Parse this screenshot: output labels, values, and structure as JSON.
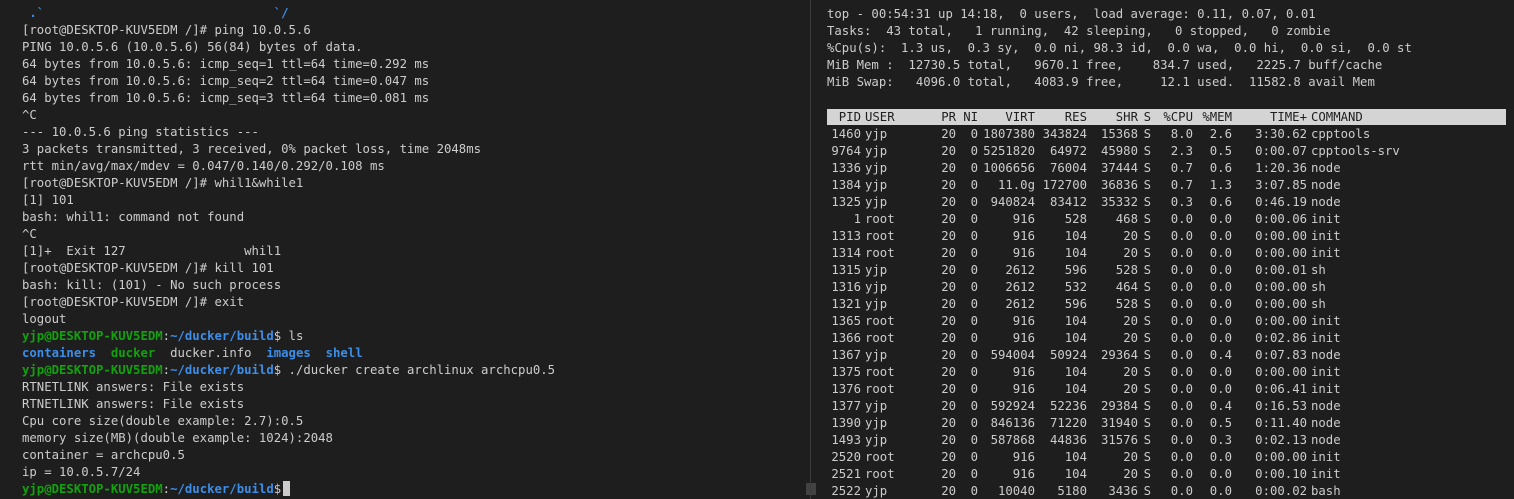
{
  "left_terminal": {
    "lines": [
      {
        "segments": [
          {
            "text": " .`                               `/",
            "cls": "blu"
          }
        ]
      },
      {
        "segments": [
          {
            "text": "[root@DESKTOP-KUV5EDM /]# ping 10.0.5.6"
          }
        ]
      },
      {
        "segments": [
          {
            "text": "PING 10.0.5.6 (10.0.5.6) 56(84) bytes of data."
          }
        ]
      },
      {
        "segments": [
          {
            "text": "64 bytes from 10.0.5.6: icmp_seq=1 ttl=64 time=0.292 ms"
          }
        ]
      },
      {
        "segments": [
          {
            "text": "64 bytes from 10.0.5.6: icmp_seq=2 ttl=64 time=0.047 ms"
          }
        ]
      },
      {
        "segments": [
          {
            "text": "64 bytes from 10.0.5.6: icmp_seq=3 ttl=64 time=0.081 ms"
          }
        ]
      },
      {
        "segments": [
          {
            "text": "^C"
          }
        ]
      },
      {
        "segments": [
          {
            "text": "--- 10.0.5.6 ping statistics ---"
          }
        ]
      },
      {
        "segments": [
          {
            "text": "3 packets transmitted, 3 received, 0% packet loss, time 2048ms"
          }
        ]
      },
      {
        "segments": [
          {
            "text": "rtt min/avg/max/mdev = 0.047/0.140/0.292/0.108 ms"
          }
        ]
      },
      {
        "segments": [
          {
            "text": "[root@DESKTOP-KUV5EDM /]# whil1&while1"
          }
        ]
      },
      {
        "segments": [
          {
            "text": "[1] 101"
          }
        ]
      },
      {
        "segments": [
          {
            "text": "bash: whil1: command not found"
          }
        ]
      },
      {
        "segments": [
          {
            "text": "^C"
          }
        ]
      },
      {
        "segments": [
          {
            "text": "[1]+  Exit 127                whil1"
          }
        ]
      },
      {
        "segments": [
          {
            "text": "[root@DESKTOP-KUV5EDM /]# kill 101"
          }
        ]
      },
      {
        "segments": [
          {
            "text": "bash: kill: (101) - No such process"
          }
        ]
      },
      {
        "segments": [
          {
            "text": "[root@DESKTOP-KUV5EDM /]# exit"
          }
        ]
      },
      {
        "segments": [
          {
            "text": "logout"
          }
        ]
      },
      {
        "segments": [
          {
            "text": "yjp@DESKTOP-KUV5EDM",
            "cls": "grn"
          },
          {
            "text": ":"
          },
          {
            "text": "~/ducker/build",
            "cls": "blu"
          },
          {
            "text": "$ ls"
          }
        ]
      },
      {
        "segments": [
          {
            "text": "containers",
            "cls": "blu"
          },
          {
            "text": "  "
          },
          {
            "text": "ducker",
            "cls": "grn"
          },
          {
            "text": "  ducker.info  "
          },
          {
            "text": "images",
            "cls": "blu"
          },
          {
            "text": "  "
          },
          {
            "text": "shell",
            "cls": "blu"
          }
        ]
      },
      {
        "segments": [
          {
            "text": "yjp@DESKTOP-KUV5EDM",
            "cls": "grn"
          },
          {
            "text": ":"
          },
          {
            "text": "~/ducker/build",
            "cls": "blu"
          },
          {
            "text": "$ ./ducker create archlinux archcpu0.5"
          }
        ]
      },
      {
        "segments": [
          {
            "text": "RTNETLINK answers: File exists"
          }
        ]
      },
      {
        "segments": [
          {
            "text": "RTNETLINK answers: File exists"
          }
        ]
      },
      {
        "segments": [
          {
            "text": "Cpu core size(double example: 2.7):0.5"
          }
        ]
      },
      {
        "segments": [
          {
            "text": "memory size(MB)(double example: 1024):2048"
          }
        ]
      },
      {
        "segments": [
          {
            "text": "container = archcpu0.5"
          }
        ]
      },
      {
        "segments": [
          {
            "text": "ip = 10.0.5.7/24"
          }
        ]
      },
      {
        "segments": [
          {
            "text": "yjp@DESKTOP-KUV5EDM",
            "cls": "grn"
          },
          {
            "text": ":"
          },
          {
            "text": "~/ducker/build",
            "cls": "blu"
          },
          {
            "text": "$"
          }
        ],
        "cursor": true
      }
    ]
  },
  "top": {
    "summary": [
      "top - 00:54:31 up 14:18,  0 users,  load average: 0.11, 0.07, 0.01",
      "Tasks:  43 total,   1 running,  42 sleeping,   0 stopped,   0 zombie",
      "%Cpu(s):  1.3 us,  0.3 sy,  0.0 ni, 98.3 id,  0.0 wa,  0.0 hi,  0.0 si,  0.0 st",
      "MiB Mem :  12730.5 total,   9670.1 free,    834.7 used,   2225.7 buff/cache",
      "MiB Swap:   4096.0 total,   4083.9 free,     12.1 used.  11582.8 avail Mem"
    ],
    "columns": [
      "PID",
      "USER",
      "PR",
      "NI",
      "VIRT",
      "RES",
      "SHR",
      "S",
      "%CPU",
      "%MEM",
      "TIME+",
      "COMMAND"
    ],
    "processes": [
      [
        "1460",
        "yjp",
        "20",
        "0",
        "1807380",
        "343824",
        "15368",
        "S",
        "8.0",
        "2.6",
        "3:30.62",
        "cpptools"
      ],
      [
        "9764",
        "yjp",
        "20",
        "0",
        "5251820",
        "64972",
        "45980",
        "S",
        "2.3",
        "0.5",
        "0:00.07",
        "cpptools-srv"
      ],
      [
        "1336",
        "yjp",
        "20",
        "0",
        "1006656",
        "76004",
        "37444",
        "S",
        "0.7",
        "0.6",
        "1:20.36",
        "node"
      ],
      [
        "1384",
        "yjp",
        "20",
        "0",
        "11.0g",
        "172700",
        "36836",
        "S",
        "0.7",
        "1.3",
        "3:07.85",
        "node"
      ],
      [
        "1325",
        "yjp",
        "20",
        "0",
        "940824",
        "83412",
        "35332",
        "S",
        "0.3",
        "0.6",
        "0:46.19",
        "node"
      ],
      [
        "1",
        "root",
        "20",
        "0",
        "916",
        "528",
        "468",
        "S",
        "0.0",
        "0.0",
        "0:00.06",
        "init"
      ],
      [
        "1313",
        "root",
        "20",
        "0",
        "916",
        "104",
        "20",
        "S",
        "0.0",
        "0.0",
        "0:00.00",
        "init"
      ],
      [
        "1314",
        "root",
        "20",
        "0",
        "916",
        "104",
        "20",
        "S",
        "0.0",
        "0.0",
        "0:00.00",
        "init"
      ],
      [
        "1315",
        "yjp",
        "20",
        "0",
        "2612",
        "596",
        "528",
        "S",
        "0.0",
        "0.0",
        "0:00.01",
        "sh"
      ],
      [
        "1316",
        "yjp",
        "20",
        "0",
        "2612",
        "532",
        "464",
        "S",
        "0.0",
        "0.0",
        "0:00.00",
        "sh"
      ],
      [
        "1321",
        "yjp",
        "20",
        "0",
        "2612",
        "596",
        "528",
        "S",
        "0.0",
        "0.0",
        "0:00.00",
        "sh"
      ],
      [
        "1365",
        "root",
        "20",
        "0",
        "916",
        "104",
        "20",
        "S",
        "0.0",
        "0.0",
        "0:00.00",
        "init"
      ],
      [
        "1366",
        "root",
        "20",
        "0",
        "916",
        "104",
        "20",
        "S",
        "0.0",
        "0.0",
        "0:02.86",
        "init"
      ],
      [
        "1367",
        "yjp",
        "20",
        "0",
        "594004",
        "50924",
        "29364",
        "S",
        "0.0",
        "0.4",
        "0:07.83",
        "node"
      ],
      [
        "1375",
        "root",
        "20",
        "0",
        "916",
        "104",
        "20",
        "S",
        "0.0",
        "0.0",
        "0:00.00",
        "init"
      ],
      [
        "1376",
        "root",
        "20",
        "0",
        "916",
        "104",
        "20",
        "S",
        "0.0",
        "0.0",
        "0:06.41",
        "init"
      ],
      [
        "1377",
        "yjp",
        "20",
        "0",
        "592924",
        "52236",
        "29384",
        "S",
        "0.0",
        "0.4",
        "0:16.53",
        "node"
      ],
      [
        "1390",
        "yjp",
        "20",
        "0",
        "846136",
        "71220",
        "31940",
        "S",
        "0.0",
        "0.5",
        "0:11.40",
        "node"
      ],
      [
        "1493",
        "yjp",
        "20",
        "0",
        "587868",
        "44836",
        "31576",
        "S",
        "0.0",
        "0.3",
        "0:02.13",
        "node"
      ],
      [
        "2520",
        "root",
        "20",
        "0",
        "916",
        "104",
        "20",
        "S",
        "0.0",
        "0.0",
        "0:00.00",
        "init"
      ],
      [
        "2521",
        "root",
        "20",
        "0",
        "916",
        "104",
        "20",
        "S",
        "0.0",
        "0.0",
        "0:00.10",
        "init"
      ],
      [
        "2522",
        "yjp",
        "20",
        "0",
        "10040",
        "5180",
        "3436",
        "S",
        "0.0",
        "0.0",
        "0:00.02",
        "bash"
      ]
    ]
  }
}
